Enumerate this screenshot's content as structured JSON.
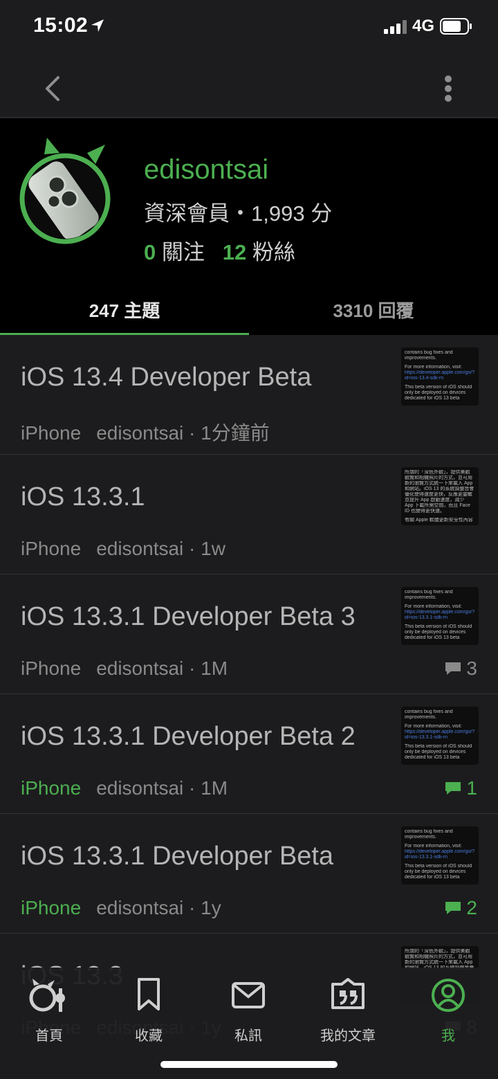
{
  "status": {
    "time": "15:02",
    "network": "4G"
  },
  "profile": {
    "username": "edisontsai",
    "member_line": "資深會員・1,993 分",
    "following_count": "0",
    "following_label": "關注",
    "followers_count": "12",
    "followers_label": "粉絲"
  },
  "tabs": [
    {
      "label": "247 主題"
    },
    {
      "label": "3310 回覆"
    }
  ],
  "posts": [
    {
      "title": "iOS 13.4 Developer Beta",
      "category": "iPhone",
      "author_time": "edisontsai · 1分鐘前",
      "comments": "",
      "thumb": [
        "contains bug fixes and",
        "improvements.",
        "",
        "For more information, visit:",
        "https://developer.apple.com/go/?",
        "id=ios-13.4-sdk-rn",
        "",
        "This beta version of iOS should",
        "only be deployed on devices",
        "dedicated for iOS 13 beta"
      ]
    },
    {
      "title": "iOS 13.3.1",
      "category": "iPhone",
      "author_time": "edisontsai · 1w",
      "comments": "",
      "thumb": [
        "所謂的「深色外觀」，提供美觀",
        "觀覽和相機照片的方式，並可用",
        "新的瀏覽方式統一下來載入 App",
        "和網站。iOS 13 的系統調整皆會",
        "優化使得速度更快，反應更靈敏",
        "並提升 App 啟動速度，減少",
        "App 下載所需空間，而且 Face",
        "ID 也變得更快速。",
        "",
        "有關 Apple 軟體更新安全性內容"
      ]
    },
    {
      "title": "iOS 13.3.1 Developer Beta 3",
      "category": "iPhone",
      "author_time": "edisontsai · 1M",
      "comments": "3",
      "thumb": [
        "contains bug fixes and",
        "improvements.",
        "",
        "For more information, visit:",
        "https://developer.apple.com/go/?",
        "id=ios-13.3.1-sdk-rn",
        "",
        "This beta version of iOS should",
        "only be deployed on devices",
        "dedicated for iOS 13 beta"
      ]
    },
    {
      "title": "iOS 13.3.1 Developer Beta 2",
      "category": "iPhone",
      "author_time": "edisontsai · 1M",
      "comments": "1",
      "thumb": [
        "contains bug fixes and",
        "improvements.",
        "",
        "For more information, visit:",
        "https://developer.apple.com/go/?",
        "id=ios-13.3.1-sdk-rn",
        "",
        "This beta version of iOS should",
        "only be deployed on devices",
        "dedicated for iOS 13 beta"
      ]
    },
    {
      "title": "iOS 13.3.1 Developer Beta",
      "category": "iPhone",
      "author_time": "edisontsai · 1y",
      "comments": "2",
      "thumb": [
        "contains bug fixes and",
        "improvements.",
        "",
        "For more information, visit:",
        "https://developer.apple.com/go/?",
        "id=ios-13.3.1-sdk-rn",
        "",
        "This beta version of iOS should",
        "only be deployed on devices",
        "dedicated for iOS 13 beta"
      ]
    },
    {
      "title": "iOS 13.3",
      "category": "iPhone",
      "author_time": "edisontsai · 1y",
      "comments": "8",
      "thumb": [
        "所謂的「深色外觀」，提供美觀",
        "觀覽和相機照片的方式，並可用",
        "新的瀏覽方式統一下來載入 App",
        "和網站。iOS 13 的系統調整皆會",
        "",
        "",
        "",
        "",
        "",
        ""
      ]
    }
  ],
  "tab_bar": [
    {
      "label": "首頁",
      "icon": "home-logo-icon"
    },
    {
      "label": "收藏",
      "icon": "bookmark-icon"
    },
    {
      "label": "私訊",
      "icon": "envelope-icon"
    },
    {
      "label": "我的文章",
      "icon": "quote-icon"
    },
    {
      "label": "我",
      "icon": "person-icon"
    }
  ],
  "colors": {
    "accent": "#4caf50",
    "background": "#1c1c1e",
    "profile_background": "#000000"
  }
}
